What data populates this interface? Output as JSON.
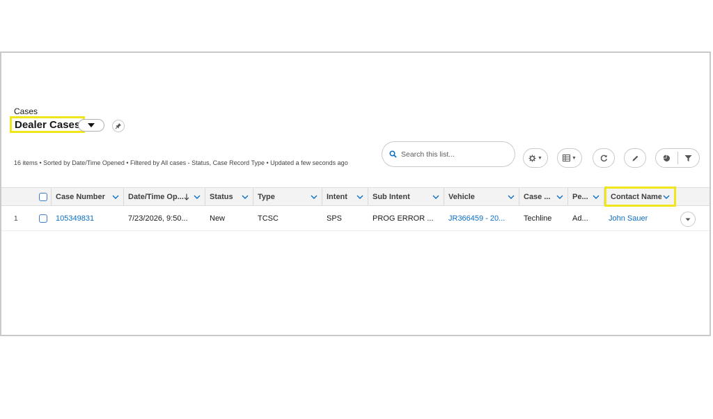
{
  "header": {
    "object_label": "Cases",
    "list_view_title": "Dealer Cases",
    "meta_info": "16 items • Sorted by Date/Time Opened • Filtered by All cases - Status, Case Record Type • Updated a few seconds ago"
  },
  "search": {
    "placeholder": "Search this list..."
  },
  "toolbar": {
    "icons": [
      "gear-icon",
      "table-icon",
      "refresh-icon",
      "pencil-icon",
      "pie-chart-icon",
      "filter-icon"
    ]
  },
  "table": {
    "columns": [
      {
        "label": "Case Number"
      },
      {
        "label": "Date/Time Op...",
        "sorted": "descending"
      },
      {
        "label": "Status"
      },
      {
        "label": "Type"
      },
      {
        "label": "Intent"
      },
      {
        "label": "Sub Intent"
      },
      {
        "label": "Vehicle"
      },
      {
        "label": "Case ..."
      },
      {
        "label": "Pe..."
      },
      {
        "label": "Contact Name"
      }
    ],
    "rows": [
      {
        "row_number": "1",
        "case_number": "105349831",
        "date_opened": "7/23/2026, 9:50...",
        "status": "New",
        "type": "TCSC",
        "intent": "SPS",
        "sub_intent": "PROG ERROR ...",
        "vehicle": "JR366459 - 20...",
        "case_origin": "Techline",
        "pe": "Ad...",
        "contact_name": "John Sauer"
      }
    ]
  },
  "colors": {
    "link": "#0b6ec4",
    "highlight": "#f1e61b",
    "checkbox": "#3c7bc9"
  }
}
